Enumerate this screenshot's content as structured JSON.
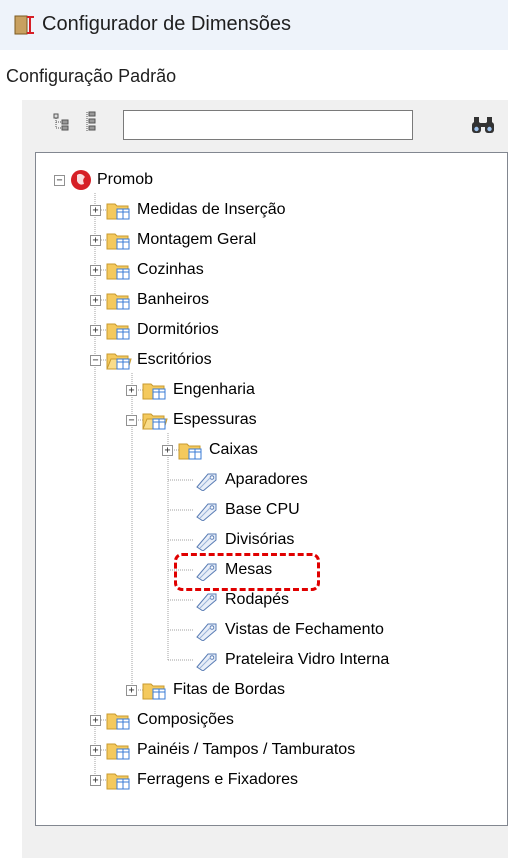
{
  "window": {
    "title": "Configurador de Dimensões"
  },
  "config": {
    "label": "Configuração Padrão"
  },
  "toolbar": {
    "search_value": "",
    "search_placeholder": ""
  },
  "tree": {
    "root": "Promob",
    "nodes": {
      "medidas": "Medidas de Inserção",
      "montagem": "Montagem Geral",
      "cozinhas": "Cozinhas",
      "banheiros": "Banheiros",
      "dormitorios": "Dormitórios",
      "escritorios": "Escritórios",
      "engenharia": "Engenharia",
      "espessuras": "Espessuras",
      "caixas": "Caixas",
      "aparadores": "Aparadores",
      "base_cpu": "Base CPU",
      "divisorias": "Divisórias",
      "mesas": "Mesas",
      "rodapes": "Rodapés",
      "vistas": "Vistas de Fechamento",
      "prateleira": "Prateleira Vidro Interna",
      "fitas": "Fitas de Bordas",
      "composicoes": "Composições",
      "paineis": "Painéis / Tampos / Tamburatos",
      "ferragens": "Ferragens e Fixadores"
    },
    "selected": "Mesas"
  },
  "colors": {
    "highlight": "#e00000",
    "folder": "#f4c95d",
    "folder_badge": "#3a7bd5",
    "promob_red": "#d61f26"
  }
}
